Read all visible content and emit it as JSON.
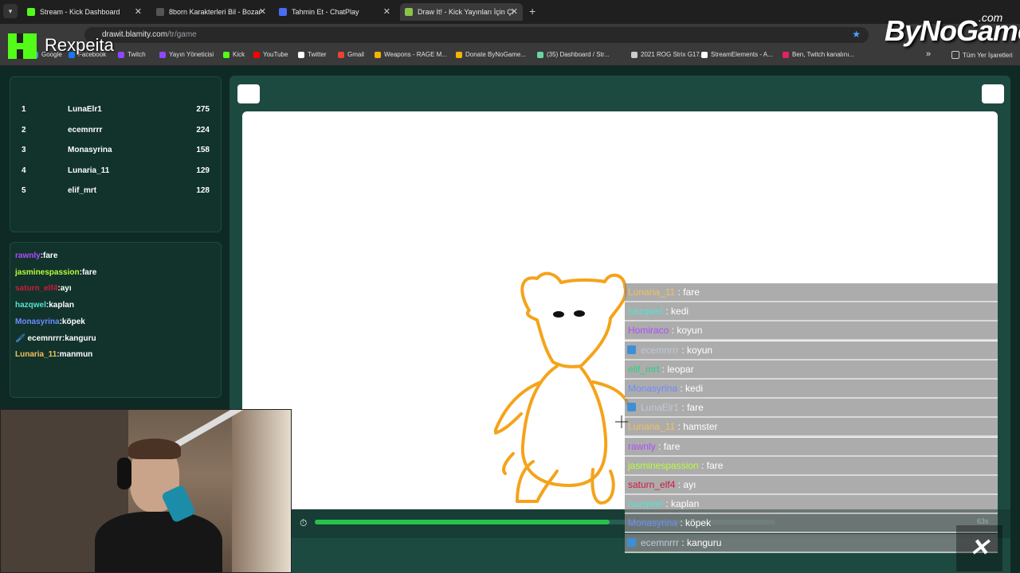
{
  "browser": {
    "tabs": [
      {
        "title": "Stream - Kick Dashboard",
        "color": "#53fc18"
      },
      {
        "title": "8born Karakterleri Bil - Bozartla",
        "color": "#555555"
      },
      {
        "title": "Tahmin Et - ChatPlay",
        "color": "#4a6cf7"
      },
      {
        "title": "Draw It! - Kick Yayınları İçin Çizi",
        "color": "#8bc34a",
        "active": true
      }
    ],
    "url_host": "drawit.blamity.com",
    "url_path": "/tr/game",
    "bookmarks": [
      {
        "label": "Google",
        "color": "#4285f4"
      },
      {
        "label": "Facebook",
        "color": "#1877f2"
      },
      {
        "label": "Twitch",
        "color": "#9146ff"
      },
      {
        "label": "Yayın Yöneticisi",
        "color": "#9146ff"
      },
      {
        "label": "Kick",
        "color": "#53fc18"
      },
      {
        "label": "YouTube",
        "color": "#ff0000"
      },
      {
        "label": "Twitter",
        "color": "#ffffff"
      },
      {
        "label": "Gmail",
        "color": "#ea4335"
      },
      {
        "label": "Weapons - RAGE M...",
        "color": "#f4b400"
      },
      {
        "label": "Donate ByNoGame...",
        "color": "#f4b400"
      },
      {
        "label": "(35) Dashboard / Str...",
        "color": "#6ad6a0"
      },
      {
        "label": "2021 ROG Strix G17...",
        "color": "#cccccc"
      },
      {
        "label": "StreamElements - A...",
        "color": "#ffffff"
      },
      {
        "label": "Ben, Twitch kanalını...",
        "color": "#e0245e"
      }
    ],
    "bookmarks_overflow": "»",
    "all_bookmarks": "Tüm Yer İşaretleri"
  },
  "overlay": {
    "streamer": "Rexpeita",
    "sponsor": "ByNoGame",
    "sponsor_tld": ".com"
  },
  "leaderboard": [
    {
      "rank": "1",
      "name": "LunaElr1",
      "score": "275"
    },
    {
      "rank": "2",
      "name": "ecemnrrr",
      "score": "224"
    },
    {
      "rank": "3",
      "name": "Monasyrina",
      "score": "158"
    },
    {
      "rank": "4",
      "name": "Lunaria_11",
      "score": "129"
    },
    {
      "rank": "5",
      "name": "elif_mrt",
      "score": "128"
    }
  ],
  "guesses": [
    {
      "user": "rawnly",
      "word": "fare",
      "color": "#b04cff"
    },
    {
      "user": "jasminespassion",
      "word": "fare",
      "color": "#b8ff3a"
    },
    {
      "user": "saturn_elf4",
      "word": "ayı",
      "color": "#d0193a"
    },
    {
      "user": "hazqwel",
      "word": "kaplan",
      "color": "#54e3cf"
    },
    {
      "user": "Monasyrina",
      "word": "köpek",
      "color": "#6d8dff"
    },
    {
      "user": "ecemnrrr",
      "word": "kanguru",
      "color": "#ffffff"
    },
    {
      "user": "Lunaria_11",
      "word": "manmun",
      "color": "#f4c05a"
    }
  ],
  "game": {
    "timer_value": "63s",
    "time_remaining_fraction": 0.64
  },
  "chat": [
    {
      "user": "Lunaria_11",
      "msg": "fare",
      "color": "#f4c05a"
    },
    {
      "user": "hazqwel",
      "msg": "kedi",
      "color": "#54e3cf"
    },
    {
      "user": "Homiraco",
      "msg": "koyun",
      "color": "#b04cff"
    },
    {
      "user": "ecemnrrr",
      "msg": "koyun",
      "color": "#c0c8d8",
      "badge": true
    },
    {
      "user": "elif_mrt",
      "msg": "leopar",
      "color": "#27d182"
    },
    {
      "user": "Monasyrina",
      "msg": "kedi",
      "color": "#6d8dff"
    },
    {
      "user": "LunaElr1",
      "msg": "fare",
      "color": "#c0c8d8",
      "badge": true
    },
    {
      "user": "Lunaria_11",
      "msg": "hamster",
      "color": "#f4c05a"
    },
    {
      "user": "rawnly",
      "msg": "fare",
      "color": "#b04cff"
    },
    {
      "user": "jasminespassion",
      "msg": "fare",
      "color": "#b8ff3a"
    },
    {
      "user": "saturn_elf4",
      "msg": "ayı",
      "color": "#d0193a"
    },
    {
      "user": "hazqwel",
      "msg": "kaplan",
      "color": "#54e3cf"
    },
    {
      "user": "Monasyrina",
      "msg": "köpek",
      "color": "#6d8dff"
    },
    {
      "user": "ecemnrrr",
      "msg": "kanguru",
      "color": "#c0c8d8",
      "badge": true
    }
  ],
  "colors": {
    "accent": "#53fc18",
    "panel": "#11332c",
    "progress": "#27c24c",
    "drawing_stroke": "#f5a31a"
  }
}
